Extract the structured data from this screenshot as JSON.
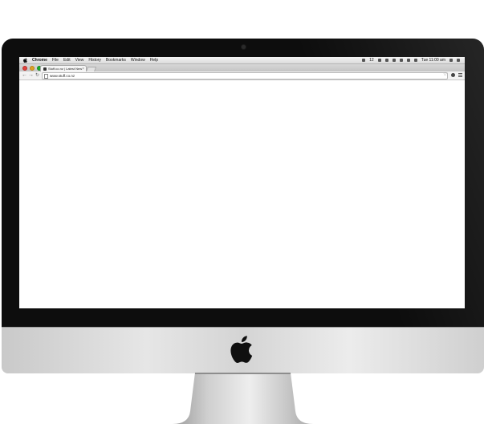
{
  "menubar": {
    "app_name": "Chrome",
    "items": [
      "File",
      "Edit",
      "View",
      "History",
      "Bookmarks",
      "Window",
      "Help"
    ],
    "battery_label": "12",
    "clock": "Tue 11:00 am"
  },
  "tab": {
    "title": "Stuff.co.nz | Latest New"
  },
  "toolbar": {
    "url": "www.stuff.co.nz"
  },
  "colors": {
    "bezel": "#0d0d0d",
    "close": "#e0443e",
    "minimize": "#dea123",
    "zoom": "#1aab29"
  }
}
